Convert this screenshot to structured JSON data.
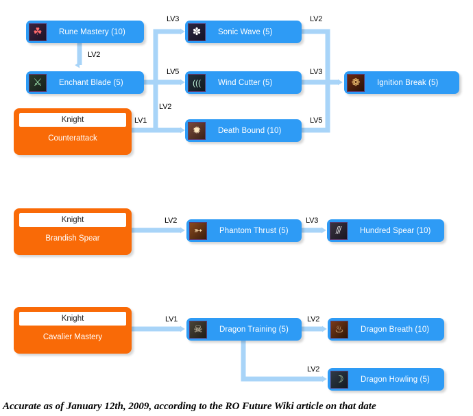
{
  "caption": "Accurate as of January 12th, 2009, according to the RO Future Wiki article on that date",
  "colors": {
    "skill_blue": "#2e9bf5",
    "class_orange": "#f96a07",
    "connector_blue": "#a8d4f8",
    "label_text": "#ffffff",
    "header_text": "#222222",
    "background": "#ffffff"
  },
  "class_header_label": "Knight",
  "nodes": {
    "rune_mastery": {
      "label": "Rune Mastery (10)",
      "icon": "rune-mastery-icon",
      "glyph": "☘"
    },
    "enchant_blade": {
      "label": "Enchant Blade (5)",
      "icon": "enchant-blade-icon",
      "glyph": "⚔"
    },
    "sonic_wave": {
      "label": "Sonic Wave (5)",
      "icon": "sonic-wave-icon",
      "glyph": "✽"
    },
    "wind_cutter": {
      "label": "Wind Cutter (5)",
      "icon": "wind-cutter-icon",
      "glyph": "((("
    },
    "death_bound": {
      "label": "Death Bound (10)",
      "icon": "death-bound-icon",
      "glyph": "✹"
    },
    "ignition_break": {
      "label": "Ignition Break (5)",
      "icon": "ignition-break-icon",
      "glyph": "❁"
    },
    "phantom_thrust": {
      "label": "Phantom Thrust (5)",
      "icon": "phantom-thrust-icon",
      "glyph": "➳"
    },
    "hundred_spear": {
      "label": "Hundred Spear (10)",
      "icon": "hundred-spear-icon",
      "glyph": "⫻"
    },
    "dragon_training": {
      "label": "Dragon Training (5)",
      "icon": "dragon-training-icon",
      "glyph": "☠"
    },
    "dragon_breath": {
      "label": "Dragon Breath (10)",
      "icon": "dragon-breath-icon",
      "glyph": "♨"
    },
    "dragon_howling": {
      "label": "Dragon Howling (5)",
      "icon": "dragon-howling-icon",
      "glyph": "☽"
    },
    "counterattack": {
      "label": "Counterattack",
      "header": "Knight"
    },
    "brandish_spear": {
      "label": "Brandish Spear",
      "header": "Knight"
    },
    "cavalier_mastery": {
      "label": "Cavalier Mastery",
      "header": "Knight"
    }
  },
  "edges": [
    {
      "id": "rune-to-enchant",
      "from": "rune_mastery",
      "to": "enchant_blade",
      "level": "LV2"
    },
    {
      "id": "enchant-to-sonic",
      "from": "enchant_blade",
      "to": "sonic_wave",
      "level": "LV3"
    },
    {
      "id": "enchant-to-wind",
      "from": "enchant_blade",
      "to": "wind_cutter",
      "level": "LV5"
    },
    {
      "id": "enchant-to-death",
      "from": "enchant_blade",
      "to": "death_bound",
      "level": "LV2"
    },
    {
      "id": "counterattack-to-death",
      "from": "counterattack",
      "to": "death_bound",
      "level": "LV1"
    },
    {
      "id": "sonic-to-ignition",
      "from": "sonic_wave",
      "to": "ignition_break",
      "level": "LV2"
    },
    {
      "id": "wind-to-ignition",
      "from": "wind_cutter",
      "to": "ignition_break",
      "level": "LV3"
    },
    {
      "id": "death-to-ignition",
      "from": "death_bound",
      "to": "ignition_break",
      "level": "LV5"
    },
    {
      "id": "brandish-to-phantom",
      "from": "brandish_spear",
      "to": "phantom_thrust",
      "level": "LV2"
    },
    {
      "id": "phantom-to-hundred",
      "from": "phantom_thrust",
      "to": "hundred_spear",
      "level": "LV3"
    },
    {
      "id": "cavalier-to-dragontraining",
      "from": "cavalier_mastery",
      "to": "dragon_training",
      "level": "LV1"
    },
    {
      "id": "dragontraining-to-breath",
      "from": "dragon_training",
      "to": "dragon_breath",
      "level": "LV2"
    },
    {
      "id": "dragontraining-to-howling",
      "from": "dragon_training",
      "to": "dragon_howling",
      "level": "LV2"
    }
  ]
}
